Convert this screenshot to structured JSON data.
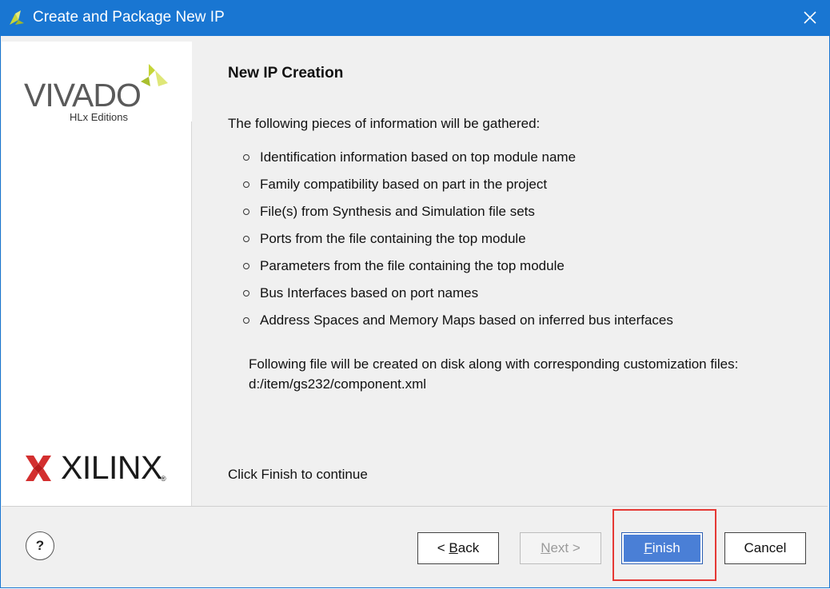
{
  "window": {
    "title": "Create and Package New IP"
  },
  "branding": {
    "product_word": "VIVADO",
    "product_sub": "HLx Editions",
    "company_word": "XILINX",
    "registered_mark": "®"
  },
  "content": {
    "heading": "New IP Creation",
    "intro": "The following pieces of information will be gathered:",
    "items": [
      "Identification information based on top module name",
      "Family compatibility based on part in the project",
      "File(s) from Synthesis and Simulation file sets",
      "Ports from the file containing the top module",
      "Parameters from the file containing the top module",
      "Bus Interfaces based on port names",
      "Address Spaces and Memory Maps based on inferred bus interfaces"
    ],
    "file_note_line1": "Following file will be created on disk along with corresponding customization files:",
    "file_note_line2": "d:/item/gs232/component.xml",
    "click_finish": "Click Finish to continue"
  },
  "footer": {
    "help_label": "?",
    "back_prefix": "< ",
    "back_mnemonic": "B",
    "back_rest": "ack",
    "next_mnemonic": "N",
    "next_rest": "ext >",
    "finish_mnemonic": "F",
    "finish_rest": "inish",
    "cancel_label": "Cancel"
  },
  "colors": {
    "titlebar": "#1976d2",
    "finish_button": "#4a7fd6",
    "highlight": "#e53935"
  }
}
